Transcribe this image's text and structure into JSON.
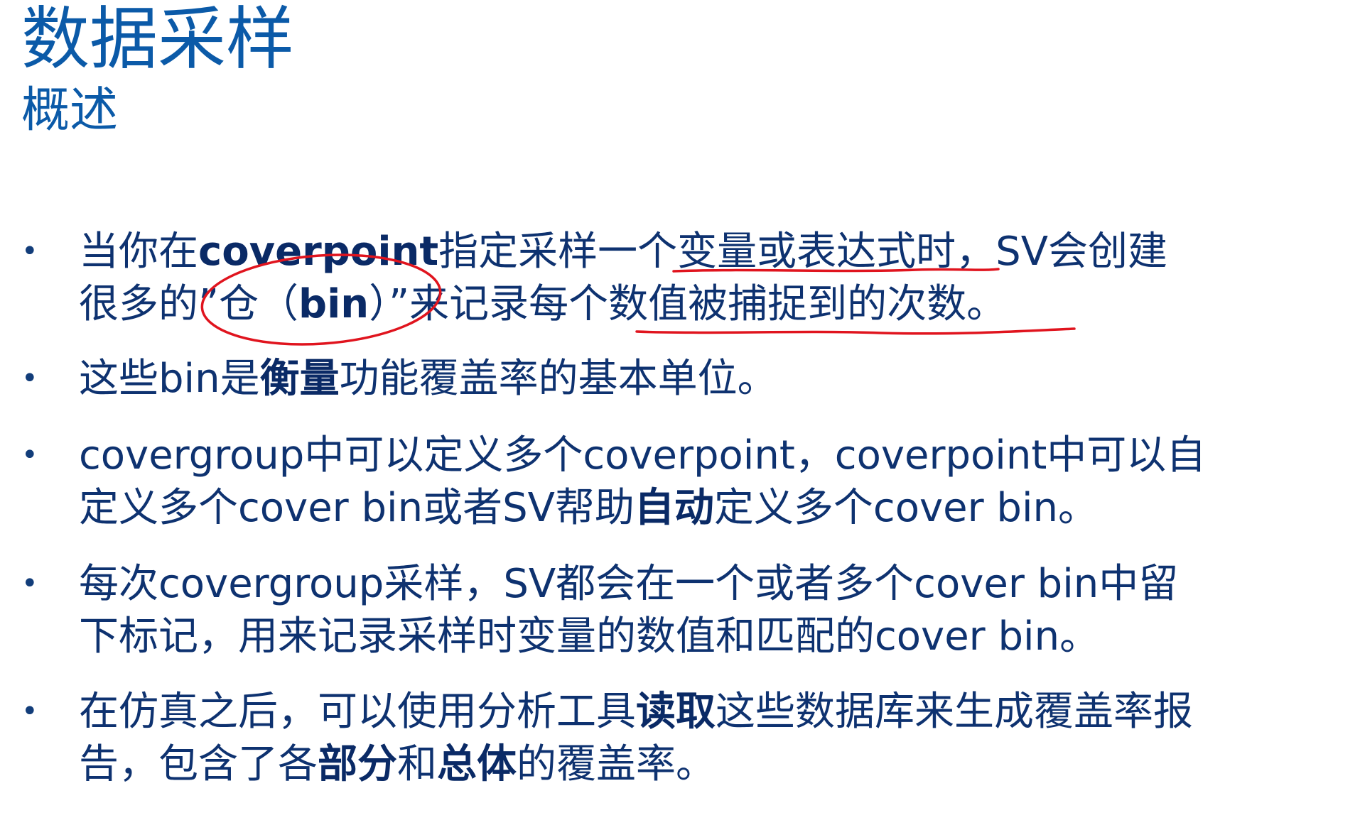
{
  "slide": {
    "title": "数据采样",
    "subtitle": "概述",
    "bullet_symbol": "•",
    "bullets": [
      {
        "l1a": "当你在",
        "l1b": "coverpoint",
        "l1c": "指定采样一个变量或表达式时，SV会创建",
        "l2a": "很多的”仓（",
        "l2b": "bin",
        "l2c": "）”来记录每个数值被捕捉到的次数。"
      },
      {
        "a": "这些bin是",
        "b": "衡量",
        "c": "功能覆盖率的基本单位。"
      },
      {
        "l1": "covergroup中可以定义多个coverpoint，coverpoint中可以自",
        "l2a": "定义多个cover bin或者SV帮助",
        "l2b": "自动",
        "l2c": "定义多个cover bin。"
      },
      {
        "l1": "每次covergroup采样，SV都会在一个或者多个cover bin中留",
        "l2": "下标记，用来记录采样时变量的数值和匹配的cover bin。"
      },
      {
        "l1a": "在仿真之后，可以使用分析工具",
        "l1b": "读取",
        "l1c": "这些数据库来生成覆盖率报",
        "l2a": "告，包含了各",
        "l2b": "部分",
        "l2c": "和",
        "l2d": "总体",
        "l2e": "的覆盖率。"
      }
    ]
  },
  "colors": {
    "title": "#0b5aa8",
    "body": "#0e3270",
    "annotation": "#e0141e"
  }
}
